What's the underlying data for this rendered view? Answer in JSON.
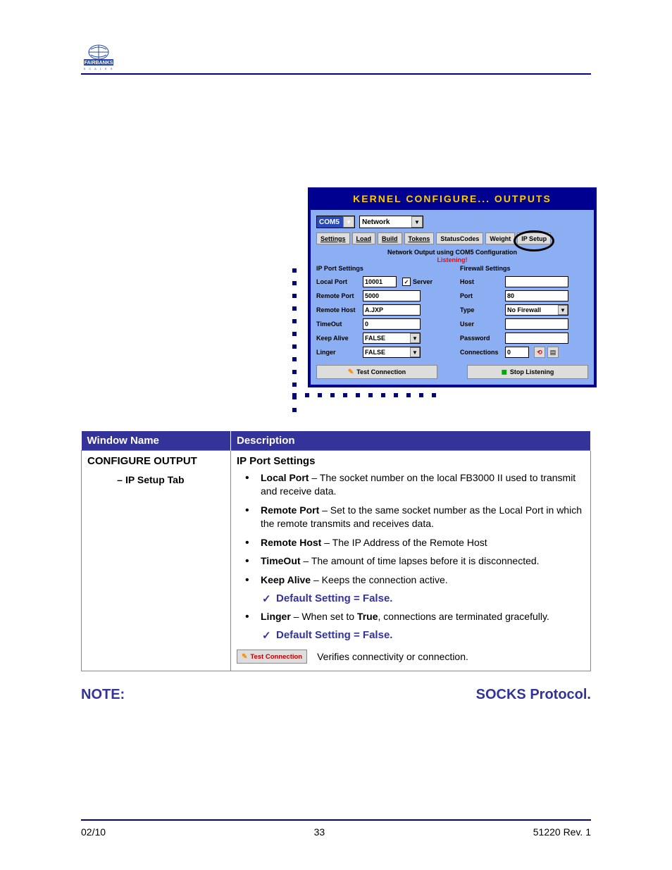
{
  "header": {
    "logo_text": "FAIRBANKS"
  },
  "dialog": {
    "title": "KERNEL CONFIGURE... OUTPUTS",
    "com_select": "COM5",
    "mode_select": "Network",
    "tabs": {
      "settings": "Settings",
      "load": "Load",
      "build": "Build",
      "tokens": "Tokens",
      "statuscodes": "StatusCodes",
      "weight": "Weight",
      "ipsetup": "IP Setup"
    },
    "section_header": "Network Output using COM5 Configuration",
    "listening": "Listening!",
    "ip_settings_title": "IP Port Settings",
    "firewall_title": "Firewall Settings",
    "ip": {
      "local_port_label": "Local Port",
      "local_port_value": "10001",
      "server_label": "Server",
      "remote_port_label": "Remote Port",
      "remote_port_value": "5000",
      "remote_host_label": "Remote Host",
      "remote_host_value": "A.JXP",
      "timeout_label": "TimeOut",
      "timeout_value": "0",
      "keep_alive_label": "Keep Alive",
      "keep_alive_value": "FALSE",
      "linger_label": "Linger",
      "linger_value": "FALSE"
    },
    "fw": {
      "host_label": "Host",
      "host_value": "",
      "port_label": "Port",
      "port_value": "80",
      "type_label": "Type",
      "type_value": "No Firewall",
      "user_label": "User",
      "user_value": "",
      "password_label": "Password",
      "password_value": "",
      "connections_label": "Connections",
      "connections_value": "0"
    },
    "test_conn": "Test Connection",
    "stop_listen": "Stop Listening"
  },
  "table": {
    "h1": "Window Name",
    "h2": "Description",
    "window_name": "CONFIGURE OUTPUT",
    "subtab": "IP Setup Tab",
    "section": "IP Port Settings",
    "items": {
      "local_port": {
        "name": "Local Port",
        "text": " – The socket number on the local FB3000 II used to transmit and receive data."
      },
      "remote_port": {
        "name": "Remote Port",
        "text": " – Set to the same socket number as the Local Port in which the remote transmits and receives data."
      },
      "remote_host": {
        "name": "Remote Host",
        "text": " – The IP Address of the Remote Host"
      },
      "timeout": {
        "name": "TimeOut",
        "text": " – The amount of time lapses before it is disconnected."
      },
      "keep_alive": {
        "name": "Keep Alive",
        "text": " – Keeps the connection active."
      },
      "linger": {
        "name": "Linger",
        "pre": " – When set to ",
        "true": "True",
        "post": ", connections are terminated gracefully."
      }
    },
    "default_setting": "Default Setting = False.",
    "test_connection_btn": "Test Connection",
    "verify_text": "Verifies connectivity or connection."
  },
  "note": {
    "label": "NOTE:",
    "proto": "SOCKS Protocol."
  },
  "footer": {
    "left": "02/10",
    "center": "33",
    "right": "51220   Rev. 1"
  }
}
